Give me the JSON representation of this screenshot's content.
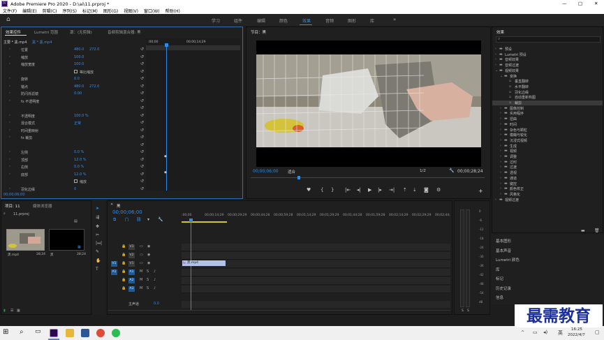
{
  "app": {
    "title": "Adobe Premiere Pro 2020 - D:\\ai\\11.prproj *",
    "win_min": "—",
    "win_max": "□",
    "win_close": "✕"
  },
  "menu": [
    "文件(F)",
    "编辑(E)",
    "剪辑(C)",
    "序列(S)",
    "标记(M)",
    "图形(G)",
    "视图(V)",
    "窗口(W)",
    "帮助(H)"
  ],
  "workspaces": [
    "学习",
    "组件",
    "编辑",
    "颜色",
    "效果",
    "音频",
    "图形",
    "库"
  ],
  "workspace_active": "效果",
  "effect_controls": {
    "tabs": [
      "效果控件",
      "Lumetri 范围",
      "源：(无剪辑)",
      "音频剪辑混合器: 黑"
    ],
    "master": "主要 * 黑.mp4",
    "clip": "黑 * 黑.mp4",
    "time_left": ":00;00",
    "time_right": "00;00;14;29",
    "timecode": "00;00;06;00",
    "rows": [
      {
        "label": "位置",
        "v1": "480.0",
        "v2": "272.0"
      },
      {
        "label": "缩放",
        "v1": "100.0",
        "v2": ""
      },
      {
        "label": "缩放宽度",
        "v1": "100.0",
        "v2": ""
      },
      {
        "label": "",
        "v1": "",
        "v2": "",
        "check": "等比缩放"
      },
      {
        "label": "旋转",
        "v1": "0.0",
        "v2": ""
      },
      {
        "label": "锚点",
        "v1": "480.0",
        "v2": "272.0"
      },
      {
        "label": "防闪烁滤镜",
        "v1": "0.00",
        "v2": ""
      },
      {
        "label": "fx 不透明度",
        "v1": "",
        "v2": ""
      },
      {
        "label": "",
        "v1": "",
        "v2": ""
      },
      {
        "label": "不透明度",
        "v1": "100.0 %",
        "v2": ""
      },
      {
        "label": "混合模式",
        "v1": "正常",
        "v2": ""
      },
      {
        "label": "时间重映射",
        "v1": "",
        "v2": ""
      },
      {
        "label": "fx 裁剪",
        "v1": "",
        "v2": ""
      },
      {
        "label": "",
        "v1": "",
        "v2": ""
      },
      {
        "label": "左侧",
        "v1": "0.0 %",
        "v2": ""
      },
      {
        "label": "顶部",
        "v1": "12.0 %",
        "v2": ""
      },
      {
        "label": "右侧",
        "v1": "0.0 %",
        "v2": ""
      },
      {
        "label": "底部",
        "v1": "12.0 %",
        "v2": ""
      },
      {
        "label": "",
        "v1": "",
        "v2": "",
        "check": "缩放"
      },
      {
        "label": "羽化边缘",
        "v1": "0",
        "v2": ""
      }
    ],
    "motion_label": "主要 * 黑.mp4"
  },
  "program": {
    "tab": "节目：黑",
    "timecode": "00;00;06;00",
    "fit": "适合",
    "quality": "1/2",
    "duration": "00;00;28;24"
  },
  "effects_panel": {
    "tab": "效果",
    "search_placeholder": "",
    "items": [
      {
        "label": "预设",
        "level": 0,
        "open": false
      },
      {
        "label": "Lumetri 预设",
        "level": 0,
        "open": false
      },
      {
        "label": "音频效果",
        "level": 0,
        "open": false
      },
      {
        "label": "音频过渡",
        "level": 0,
        "open": false
      },
      {
        "label": "视频效果",
        "level": 0,
        "open": true
      },
      {
        "label": "变换",
        "level": 1,
        "open": true
      },
      {
        "label": "垂直翻转",
        "level": 2
      },
      {
        "label": "水平翻转",
        "level": 2
      },
      {
        "label": "羽化边缘",
        "level": 2
      },
      {
        "label": "自动重新构图",
        "level": 2
      },
      {
        "label": "裁剪",
        "level": 2,
        "selected": true
      },
      {
        "label": "图像控制",
        "level": 1,
        "open": false
      },
      {
        "label": "实用程序",
        "level": 1,
        "open": false
      },
      {
        "label": "扭曲",
        "level": 1,
        "open": false
      },
      {
        "label": "时间",
        "level": 1,
        "open": false
      },
      {
        "label": "杂色与颗粒",
        "level": 1,
        "open": false
      },
      {
        "label": "模糊与锐化",
        "level": 1,
        "open": false
      },
      {
        "label": "沉浸式视频",
        "level": 1,
        "open": false
      },
      {
        "label": "生成",
        "level": 1,
        "open": false
      },
      {
        "label": "视频",
        "level": 1,
        "open": false
      },
      {
        "label": "调整",
        "level": 1,
        "open": false
      },
      {
        "label": "过时",
        "level": 1,
        "open": false
      },
      {
        "label": "过渡",
        "level": 1,
        "open": false
      },
      {
        "label": "透视",
        "level": 1,
        "open": false
      },
      {
        "label": "通道",
        "level": 1,
        "open": false
      },
      {
        "label": "键控",
        "level": 1,
        "open": false
      },
      {
        "label": "颜色校正",
        "level": 1,
        "open": false
      },
      {
        "label": "风格化",
        "level": 1,
        "open": false
      },
      {
        "label": "视频过渡",
        "level": 0,
        "open": false
      }
    ],
    "lower_panels": [
      "基本图形",
      "基本声音",
      "Lumetri 颜色",
      "库",
      "标记",
      "历史记录",
      "信息"
    ]
  },
  "project": {
    "tabs": [
      "项目: 11",
      "媒体浏览器"
    ],
    "file": "11.prproj",
    "clips": [
      {
        "name": "黑.mp4",
        "duration": "28;24"
      },
      {
        "name": "黑",
        "duration": "28;24"
      }
    ]
  },
  "timeline": {
    "tab": "黑",
    "timecode": "00;00;06;00",
    "ruler": [
      ":00;00",
      "00;00;14;29",
      "00;00;29;29",
      "00;00;44;28",
      "00;00;59;28",
      "00;01;14;29",
      "00;01;29;29",
      "00;01;44;28",
      "00;01;59;28",
      "00;02;14;29",
      "00;02;29;29",
      "00;02;44;"
    ],
    "video_tracks": [
      "V3",
      "V2",
      "V1"
    ],
    "audio_tracks": [
      "A1",
      "A2",
      "A3"
    ],
    "src_v": "V1",
    "src_a": "A1",
    "master": "主声道",
    "master_val": "0.0",
    "clip": "黑.mp4"
  },
  "meter": {
    "scale": [
      "0",
      "-6",
      "-12",
      "-18",
      "-24",
      "-30",
      "-36",
      "-42",
      "-48",
      "-54",
      "dB"
    ],
    "bottom": [
      "S",
      "S"
    ]
  },
  "taskbar": {
    "time": "16:25",
    "date": "2022/4/7"
  },
  "watermark": "最需教育"
}
